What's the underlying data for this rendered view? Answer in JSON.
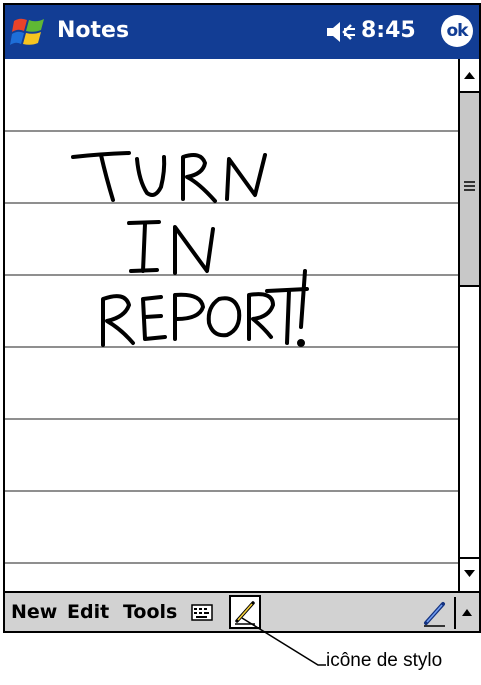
{
  "titlebar": {
    "app_title": "Notes",
    "time": "8:45",
    "ok_label": "ok",
    "start_icon": "windows-flag-icon",
    "volume_icon": "speaker-icon",
    "bg_color": "#123d94"
  },
  "note": {
    "handwriting_lines": [
      "TURN",
      "IN",
      "REPORT!"
    ],
    "ink_color": "#000000"
  },
  "menubar": {
    "items": [
      "New",
      "Edit",
      "Tools"
    ],
    "keyboard_icon": "keyboard-icon",
    "pen_icon": "pen-icon",
    "input_arrow_icon": "up-arrow-icon"
  },
  "scrollbar": {
    "up_icon": "up-arrow-icon",
    "down_icon": "down-arrow-icon"
  },
  "callout": {
    "label": "icône de stylo"
  }
}
